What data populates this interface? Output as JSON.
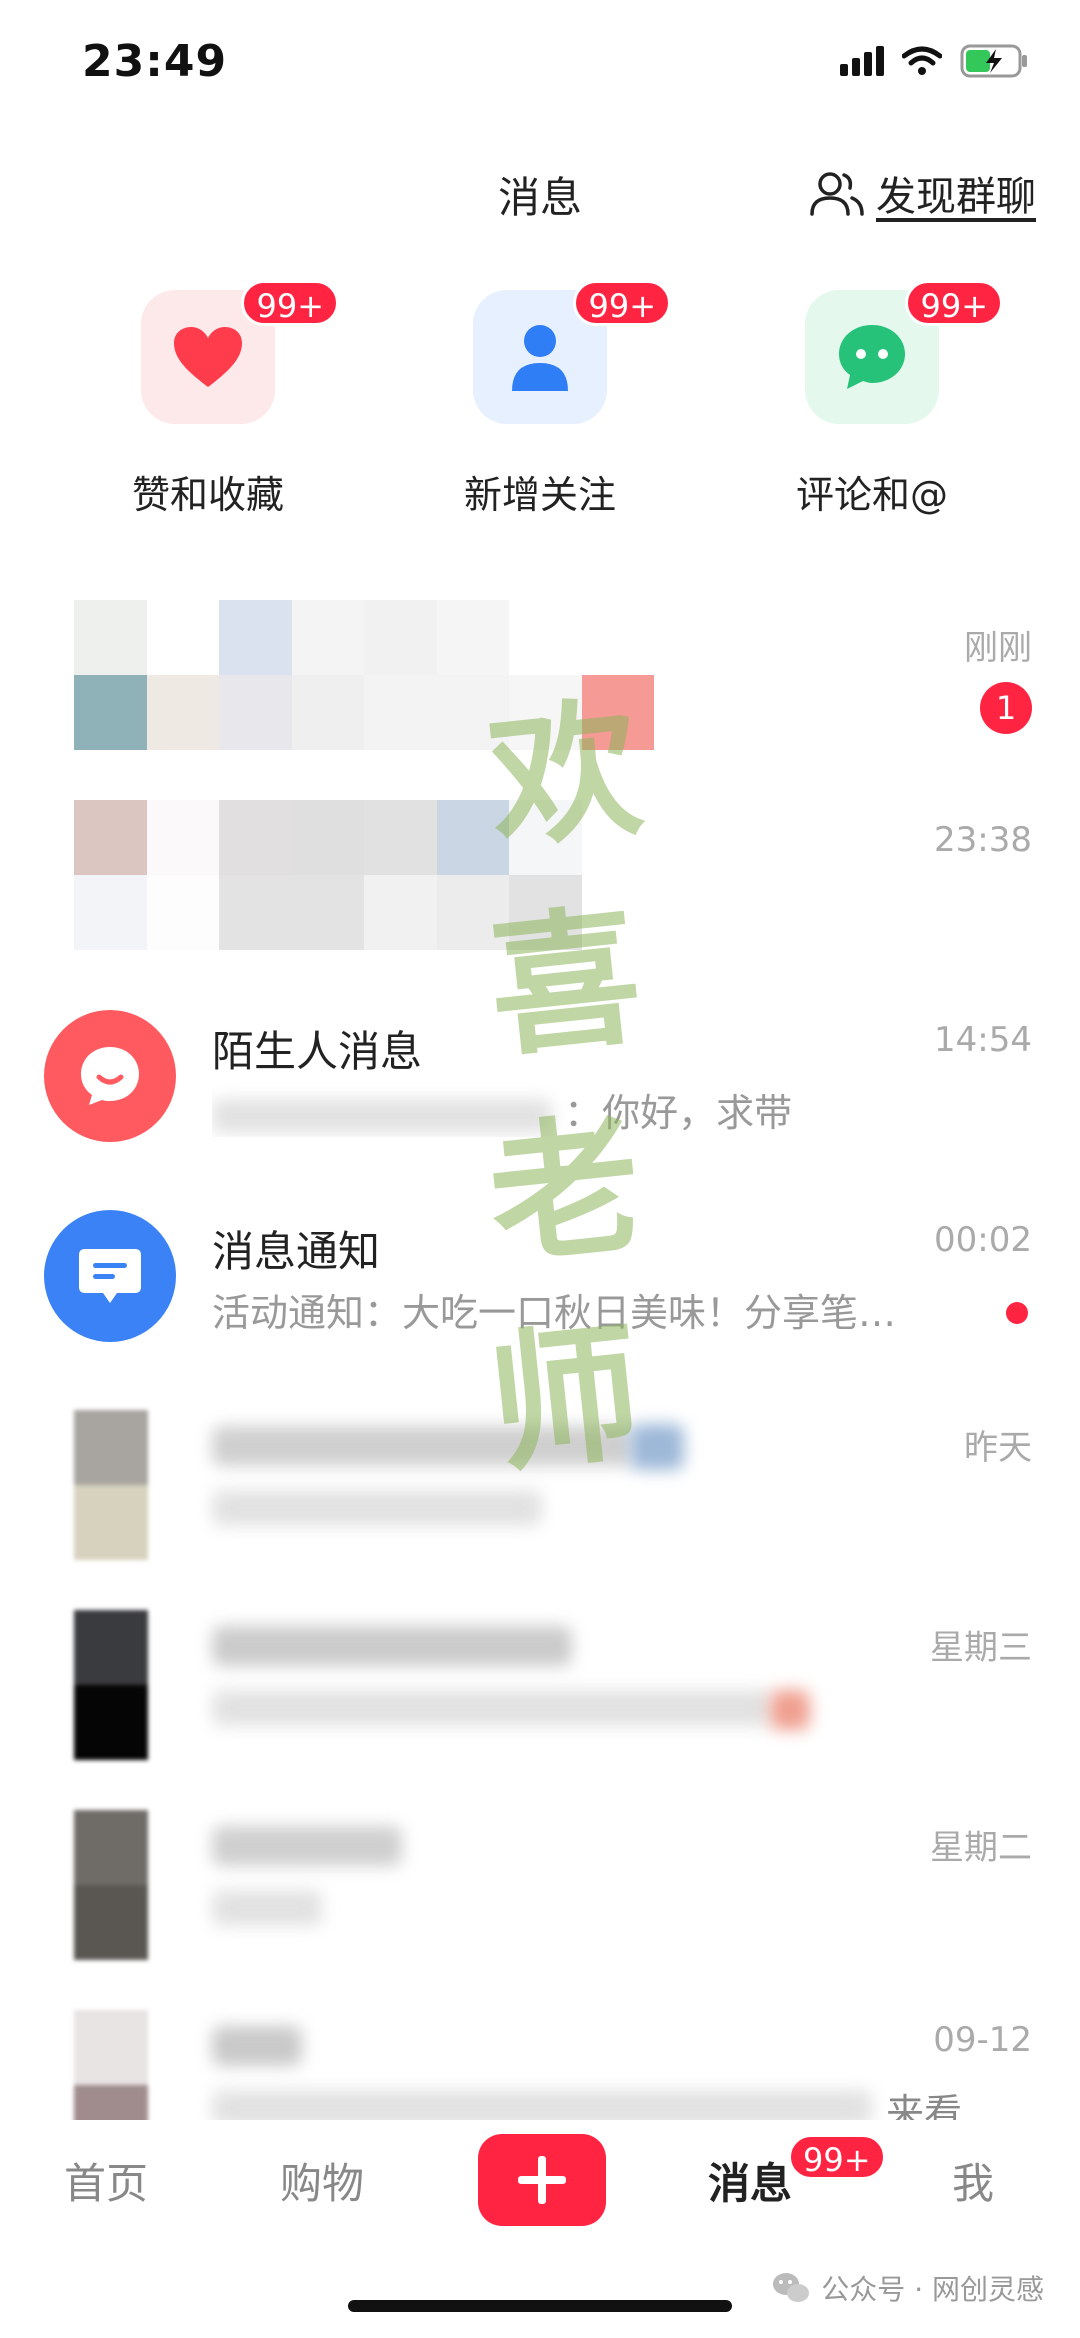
{
  "status_bar": {
    "time": "23:49"
  },
  "header": {
    "title": "消息",
    "discover_label": "发现群聊"
  },
  "quick_actions": [
    {
      "label": "赞和收藏",
      "badge": "99+",
      "icon": "heart-icon",
      "bg": "#fde8ea",
      "color": "#ff3c4c"
    },
    {
      "label": "新增关注",
      "badge": "99+",
      "icon": "user-icon",
      "bg": "#e6f0ff",
      "color": "#2f7ef5"
    },
    {
      "label": "评论和@",
      "badge": "99+",
      "icon": "chat-bubble-icon",
      "bg": "#e4f8ee",
      "color": "#27c27a"
    }
  ],
  "conversations": [
    {
      "time": "刚刚",
      "unread": "1"
    },
    {
      "time": "23:38"
    },
    {
      "name": "陌生人消息",
      "preview": "：你好，求带",
      "time": "14:54"
    },
    {
      "name": "消息通知",
      "preview": "活动通知：大吃一口秋日美味！分享笔…",
      "time": "00:02"
    },
    {
      "time": "昨天"
    },
    {
      "time": "星期三"
    },
    {
      "time": "星期二"
    },
    {
      "time": "09-12",
      "preview_tail": "来看…"
    }
  ],
  "watermark": [
    "欢",
    "喜",
    "老",
    "师"
  ],
  "bottom_nav": {
    "home": "首页",
    "shop": "购物",
    "messages": "消息",
    "messages_badge": "99+",
    "me": "我"
  },
  "footer_mark": "公众号 · 网创灵感",
  "colors": {
    "accent": "#ff2442",
    "stranger": "#ff5a5f",
    "notify": "#3b82f6"
  }
}
